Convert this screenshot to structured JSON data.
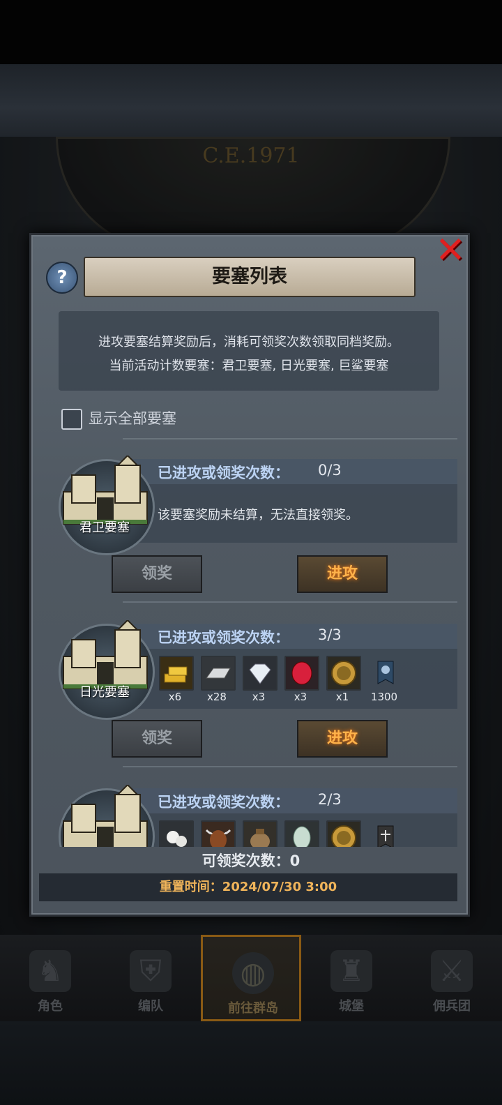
{
  "background": {
    "dial_title": "C.E.1971"
  },
  "modal": {
    "title": "要塞列表",
    "description_line1": "进攻要塞结算奖励后，消耗可领奖次数领取同档奖励。",
    "description_line2": "当前活动计数要塞：君卫要塞, 日光要塞, 巨鲨要塞",
    "show_all_label": "显示全部要塞",
    "show_all_checked": false,
    "claims_left": "可领奖次数：0",
    "reset_time": "重置时间：2024/07/30 3:00"
  },
  "forts": [
    {
      "name": "君卫要塞",
      "attempts_label": "已进攻或领奖次数：",
      "attempts": "0/3",
      "message": "该要塞奖励未结算，无法直接领奖。",
      "claim_label": "领奖",
      "attack_label": "进攻"
    },
    {
      "name": "日光要塞",
      "attempts_label": "已进攻或领奖次数：",
      "attempts": "3/3",
      "rewards": [
        {
          "icon": "gold-bars-icon",
          "qty": "x6"
        },
        {
          "icon": "iron-bar-icon",
          "qty": "x28"
        },
        {
          "icon": "diamond-icon",
          "qty": "x3"
        },
        {
          "icon": "ruby-icon",
          "qty": "x3"
        },
        {
          "icon": "knight-medal-icon",
          "qty": "x1"
        },
        {
          "icon": "banner-emblem-icon",
          "qty": "1300"
        }
      ],
      "claim_label": "领奖",
      "attack_label": "进攻"
    },
    {
      "name": "",
      "attempts_label": "已进攻或领奖次数：",
      "attempts": "2/3",
      "rewards": [
        {
          "icon": "pearl-icon"
        },
        {
          "icon": "ox-icon"
        },
        {
          "icon": "sack-icon"
        },
        {
          "icon": "jade-icon"
        },
        {
          "icon": "knight-medal-icon"
        },
        {
          "icon": "scales-emblem-icon"
        }
      ]
    }
  ],
  "bottom_nav": [
    {
      "label": "角色",
      "icon": "knight-helmet-icon",
      "active": false
    },
    {
      "label": "编队",
      "icon": "armor-icon",
      "active": false
    },
    {
      "label": "前往群岛",
      "icon": "globe-icon",
      "active": true
    },
    {
      "label": "城堡",
      "icon": "castle-icon",
      "active": false
    },
    {
      "label": "佣兵团",
      "icon": "mercenary-icon",
      "active": false
    }
  ],
  "colors": {
    "accent_orange": "#ffb24a",
    "label_blue": "#bcd3f3",
    "reset_text": "#f0b45a",
    "close_red": "#e02020"
  }
}
